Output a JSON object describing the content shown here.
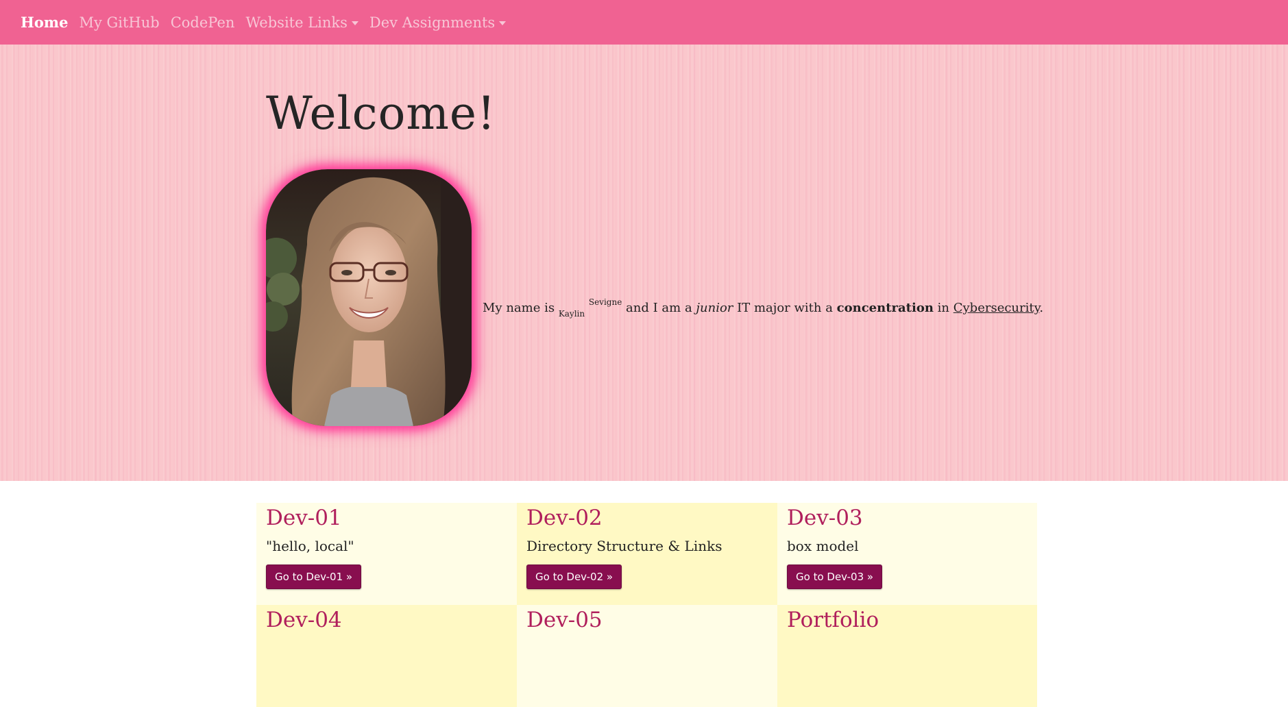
{
  "navbar": {
    "items": [
      {
        "label": "Home",
        "active": true,
        "dropdown": false
      },
      {
        "label": "My GitHub",
        "active": false,
        "dropdown": false
      },
      {
        "label": "CodePen",
        "active": false,
        "dropdown": false
      },
      {
        "label": "Website Links",
        "active": false,
        "dropdown": true
      },
      {
        "label": "Dev Assignments",
        "active": false,
        "dropdown": true
      }
    ]
  },
  "hero": {
    "title": "Welcome!",
    "intro": {
      "prefix": "My name is ",
      "first_name": "Kaylin",
      "last_name": "Sevigne",
      "part1": " and I am a ",
      "emphasis": "junior",
      "part2": " IT major with a ",
      "strong": "concentration",
      "part3": " in ",
      "link": "Cybersecurity",
      "suffix": "."
    }
  },
  "cards": [
    {
      "title": "Dev-01",
      "description": "\"hello, local\"",
      "button": "Go to Dev-01 »"
    },
    {
      "title": "Dev-02",
      "description": "Directory Structure & Links",
      "button": "Go to Dev-02 »"
    },
    {
      "title": "Dev-03",
      "description": "box model",
      "button": "Go to Dev-03 »"
    },
    {
      "title": "Dev-04",
      "description": "",
      "button": ""
    },
    {
      "title": "Dev-05",
      "description": "",
      "button": ""
    },
    {
      "title": "Portfolio",
      "description": "",
      "button": ""
    }
  ],
  "colors": {
    "navbar": "#f06292",
    "hero_bg": "#fac6cb",
    "card_title": "#b01f5c",
    "button": "#880e4f",
    "card_light": "#fffde6",
    "card_dark": "#fff9c4",
    "portrait_glow": "#ff3f9a"
  }
}
